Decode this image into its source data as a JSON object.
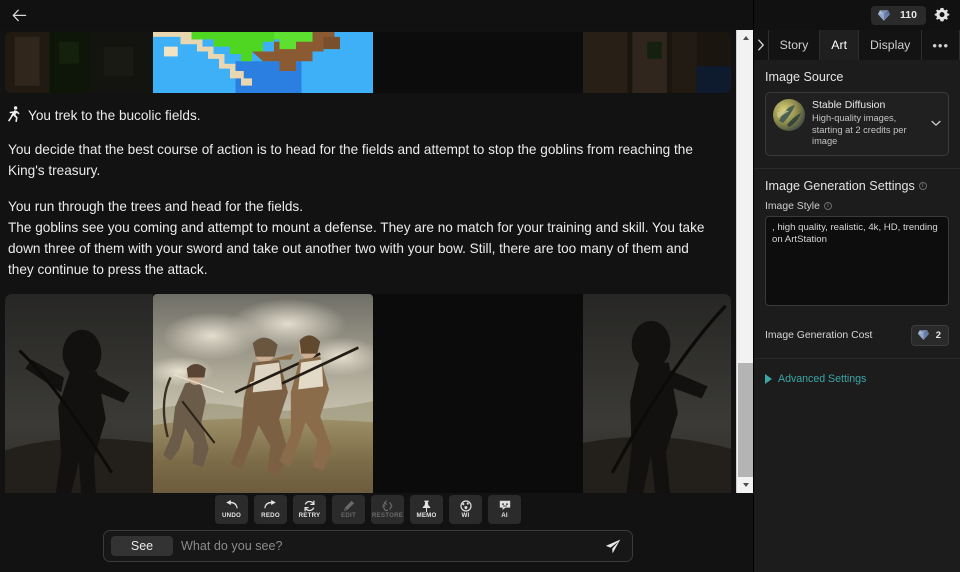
{
  "app": {
    "background": "#111111",
    "accent": "#3aa6a6"
  },
  "topbar": {
    "back_icon": "arrow-left-icon"
  },
  "header": {
    "credits_value": "110",
    "credits_icon": "gem-icon",
    "settings_icon": "gear-icon"
  },
  "tabs": {
    "expand_icon": "chevron-right-icon",
    "items": [
      {
        "label": "Story",
        "active": false
      },
      {
        "label": "Art",
        "active": true
      },
      {
        "label": "Display",
        "active": false
      }
    ],
    "more_label": "•••"
  },
  "art_panel": {
    "image_source": {
      "title": "Image Source",
      "selected_name": "Stable Diffusion",
      "selected_desc": "High-quality images, starting at 2 credits per image",
      "chevron_icon": "chevron-down-icon"
    },
    "generation_settings": {
      "title": "Image Generation Settings",
      "style_label": "Image Style",
      "style_value": ", high quality, realistic, 4k, HD, trending on ArtStation",
      "style_placeholder": "Image Style",
      "cost_label": "Image Generation Cost",
      "cost_value": "2",
      "cost_icon": "gem-icon"
    },
    "advanced": {
      "label": "Advanced Settings",
      "caret_icon": "caret-right-icon",
      "expanded": false
    }
  },
  "story": {
    "action_icon": "running-person-icon",
    "action_line": "You trek to the bucolic fields.",
    "paragraphs": [
      "You decide that the best course of action is to head for the fields and attempt to stop the goblins from reaching the King's treasury.",
      "You run through the trees and head for the fields.",
      "The goblins see you coming and attempt to mount a defense. They are no match for your training and skill. You take down three of them with your sword and take out another two with your bow. Still, there are too many of them and they continue to press the attack."
    ],
    "top_image_alt": "pixel-art landscape with cliffs and blue water",
    "main_image_alt": "three archers and spear warriors fighting on a hillside"
  },
  "toolbar": {
    "buttons": [
      {
        "label": "UNDO",
        "icon": "undo-arrow-icon",
        "disabled": false
      },
      {
        "label": "REDO",
        "icon": "redo-arrow-icon",
        "disabled": false
      },
      {
        "label": "RETRY",
        "icon": "refresh-icon",
        "disabled": false
      },
      {
        "label": "EDIT",
        "icon": "pencil-icon",
        "disabled": true
      },
      {
        "label": "RESTORE",
        "icon": "restore-icon",
        "disabled": true
      },
      {
        "label": "MEMO",
        "icon": "pin-icon",
        "disabled": false
      },
      {
        "label": "WI",
        "icon": "globe-icon",
        "disabled": false
      },
      {
        "label": "AI",
        "icon": "chat-ai-icon",
        "disabled": false
      }
    ]
  },
  "prompt": {
    "mode_label": "See",
    "placeholder": "What do you see?",
    "value": "",
    "send_icon": "send-paper-plane-icon"
  },
  "scrollbar": {
    "up_icon": "caret-up-icon",
    "down_icon": "caret-down-icon"
  }
}
